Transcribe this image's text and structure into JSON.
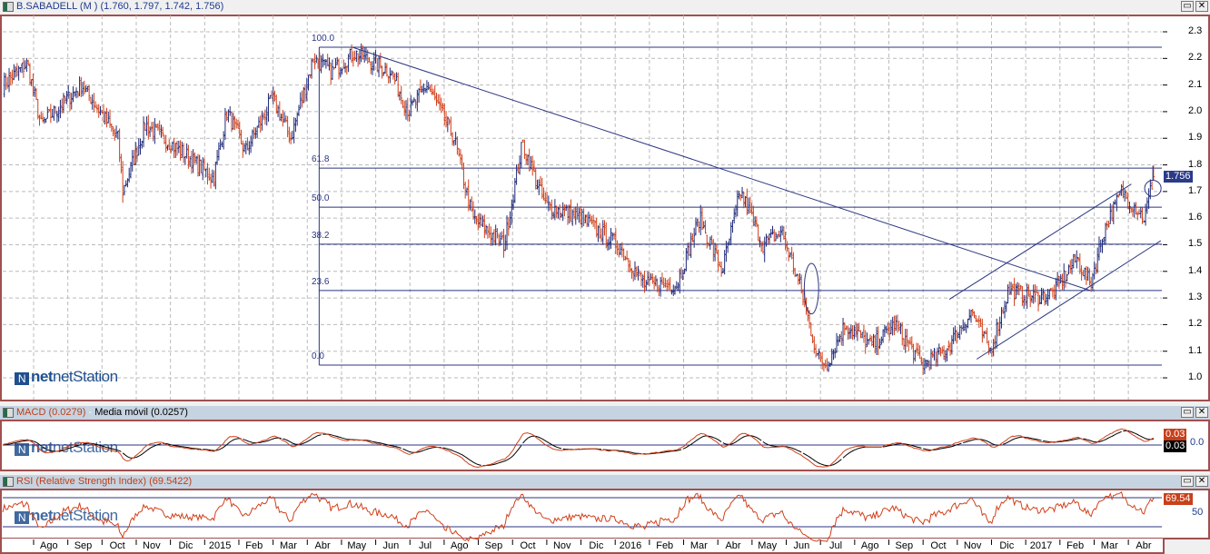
{
  "window": {
    "title": "B.SABADELL (M ) (1.760, 1.797, 1.742, 1.756)",
    "restore_label": "▭",
    "close_label": "✕"
  },
  "logo": {
    "text": "netStation"
  },
  "chart_data": [
    {
      "type": "candlestick",
      "title": "B.SABADELL (M )",
      "ohlc_last": {
        "open": 1.76,
        "high": 1.797,
        "low": 1.742,
        "close": 1.756
      },
      "time_unit": "months since 2014-08-01",
      "xlim": [
        -0.9,
        33.0
      ],
      "ylim": [
        0.92,
        2.35
      ],
      "y_ticks": [
        "2.3",
        "2.2",
        "2.1",
        "2.0",
        "1.9",
        "1.8",
        "1.7",
        "1.6",
        "1.5",
        "1.4",
        "1.3",
        "1.2",
        "1.1",
        "1.0"
      ],
      "last_price_label": "1.756",
      "colors": {
        "up": "#1f2a7a",
        "down": "#d0401a"
      },
      "close_keyframes": [
        [
          -0.85,
          2.1
        ],
        [
          -0.13,
          2.18
        ],
        [
          0.27,
          1.95
        ],
        [
          1.46,
          2.1
        ],
        [
          2.52,
          1.9
        ],
        [
          2.66,
          1.7
        ],
        [
          3.32,
          1.95
        ],
        [
          4.38,
          1.85
        ],
        [
          5.31,
          1.75
        ],
        [
          5.71,
          2.0
        ],
        [
          6.24,
          1.85
        ],
        [
          7.04,
          2.05
        ],
        [
          7.57,
          1.9
        ],
        [
          8.23,
          2.2
        ],
        [
          8.76,
          2.15
        ],
        [
          9.43,
          2.22
        ],
        [
          10.49,
          2.15
        ],
        [
          11.02,
          2.0
        ],
        [
          11.55,
          2.1
        ],
        [
          12.35,
          1.9
        ],
        [
          12.88,
          1.6
        ],
        [
          13.81,
          1.5
        ],
        [
          14.34,
          1.88
        ],
        [
          15.0,
          1.65
        ],
        [
          16.06,
          1.6
        ],
        [
          17.13,
          1.5
        ],
        [
          17.92,
          1.35
        ],
        [
          18.85,
          1.35
        ],
        [
          19.52,
          1.6
        ],
        [
          20.18,
          1.4
        ],
        [
          20.71,
          1.7
        ],
        [
          21.38,
          1.5
        ],
        [
          21.91,
          1.55
        ],
        [
          22.44,
          1.35
        ],
        [
          22.97,
          1.08
        ],
        [
          23.23,
          1.05
        ],
        [
          23.77,
          1.2
        ],
        [
          24.56,
          1.12
        ],
        [
          25.23,
          1.2
        ],
        [
          26.02,
          1.05
        ],
        [
          26.69,
          1.1
        ],
        [
          27.48,
          1.25
        ],
        [
          28.01,
          1.1
        ],
        [
          28.55,
          1.33
        ],
        [
          29.34,
          1.3
        ],
        [
          29.87,
          1.32
        ],
        [
          30.54,
          1.45
        ],
        [
          30.94,
          1.35
        ],
        [
          31.33,
          1.55
        ],
        [
          31.86,
          1.7
        ],
        [
          32.53,
          1.6
        ],
        [
          32.79,
          1.756
        ]
      ],
      "fibonacci": {
        "levels": [
          {
            "label": "100.0",
            "price": 2.242
          },
          {
            "label": "61.8",
            "price": 1.788
          },
          {
            "label": "50.0",
            "price": 1.641
          },
          {
            "label": "38.2",
            "price": 1.502
          },
          {
            "label": "23.6",
            "price": 1.328
          },
          {
            "label": "0.0",
            "price": 1.048
          }
        ],
        "start_t": 8.4
      },
      "trendlines": [
        {
          "t1": 9.37,
          "p1": 2.242,
          "t2": 30.94,
          "p2": 1.328
        },
        {
          "t1": 26.82,
          "p1": 1.295,
          "t2": 32.14,
          "p2": 1.728
        },
        {
          "t1": 27.62,
          "p1": 1.07,
          "t2": 33.0,
          "p2": 1.515
        }
      ],
      "ellipses": [
        {
          "t": 22.79,
          "p": 1.335,
          "rt": 0.21,
          "rp": 0.095
        },
        {
          "t": 32.77,
          "p": 1.712,
          "rt": 0.24,
          "rp": 0.03
        }
      ],
      "x_ticks": [
        {
          "t": 0.5,
          "label": "Ago"
        },
        {
          "t": 1.5,
          "label": "Sep"
        },
        {
          "t": 2.5,
          "label": "Oct"
        },
        {
          "t": 3.5,
          "label": "Nov"
        },
        {
          "t": 4.5,
          "label": "Dic"
        },
        {
          "t": 5.5,
          "label": "2015"
        },
        {
          "t": 6.5,
          "label": "Feb"
        },
        {
          "t": 7.5,
          "label": "Mar"
        },
        {
          "t": 8.5,
          "label": "Abr"
        },
        {
          "t": 9.5,
          "label": "May"
        },
        {
          "t": 10.5,
          "label": "Jun"
        },
        {
          "t": 11.5,
          "label": "Jul"
        },
        {
          "t": 12.5,
          "label": "Ago"
        },
        {
          "t": 13.5,
          "label": "Sep"
        },
        {
          "t": 14.5,
          "label": "Oct"
        },
        {
          "t": 15.5,
          "label": "Nov"
        },
        {
          "t": 16.5,
          "label": "Dic"
        },
        {
          "t": 17.5,
          "label": "2016"
        },
        {
          "t": 18.5,
          "label": "Feb"
        },
        {
          "t": 19.5,
          "label": "Mar"
        },
        {
          "t": 20.5,
          "label": "Abr"
        },
        {
          "t": 21.5,
          "label": "May"
        },
        {
          "t": 22.5,
          "label": "Jun"
        },
        {
          "t": 23.5,
          "label": "Jul"
        },
        {
          "t": 24.5,
          "label": "Ago"
        },
        {
          "t": 25.5,
          "label": "Sep"
        },
        {
          "t": 26.5,
          "label": "Oct"
        },
        {
          "t": 27.5,
          "label": "Nov"
        },
        {
          "t": 28.5,
          "label": "Dic"
        },
        {
          "t": 29.5,
          "label": "2017"
        },
        {
          "t": 30.5,
          "label": "Feb"
        },
        {
          "t": 31.5,
          "label": "Mar"
        },
        {
          "t": 32.5,
          "label": "Abr"
        }
      ]
    },
    {
      "type": "line",
      "title": "MACD",
      "legend": [
        {
          "name": "MACD (0.0279)",
          "color": "#d0401a"
        },
        {
          "name": "Media móvil (0.0257)",
          "color": "#000000"
        }
      ],
      "separator": " - ",
      "ylim": [
        -0.12,
        0.12
      ],
      "zero_label": "0.0",
      "macd_label": "0.03",
      "signal_label": "0.03"
    },
    {
      "type": "line",
      "title": "RSI (Relative Strength Index) (69.5422)",
      "color": "#d0401a",
      "ylim": [
        20,
        85
      ],
      "levels": [
        30,
        70
      ],
      "mid_label": "50",
      "last_label": "69.54"
    }
  ]
}
